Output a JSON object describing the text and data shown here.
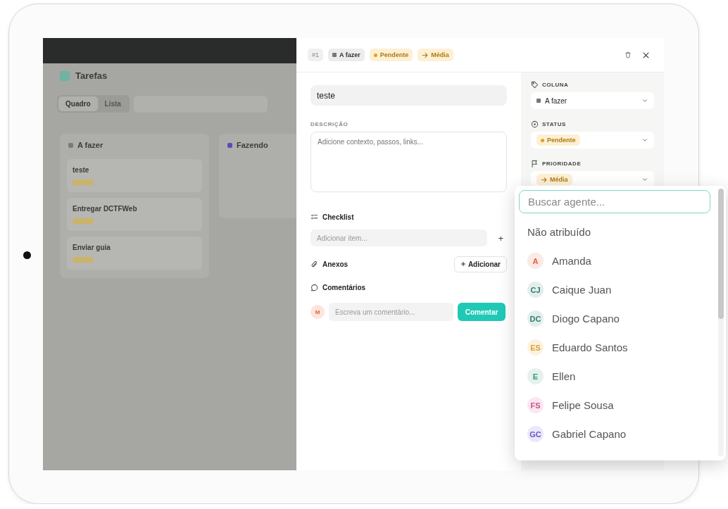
{
  "board": {
    "title": "Tarefas",
    "view_tabs": [
      {
        "label": "Quadro",
        "selected": true
      },
      {
        "label": "Lista",
        "selected": false
      }
    ],
    "columns": [
      {
        "name": "A fazer",
        "color": "#7a7a78",
        "cards": [
          {
            "title": "teste"
          },
          {
            "title": "Entregar DCTFWeb"
          },
          {
            "title": "Enviar guia"
          }
        ]
      },
      {
        "name": "Fazendo",
        "color": "#5a4bb8"
      }
    ]
  },
  "task": {
    "number": "#1",
    "badges": [
      {
        "kind": "column",
        "label": "A fazer"
      },
      {
        "kind": "status",
        "label": "Pendente"
      },
      {
        "kind": "priority",
        "label": "Média"
      }
    ],
    "title_value": "teste",
    "description": {
      "label": "DESCRIÇÃO",
      "placeholder": "Adicione contexto, passos, links..."
    },
    "checklist": {
      "label": "Checklist",
      "placeholder": "Adicionar item...",
      "add": "+"
    },
    "attachments": {
      "label": "Anexos",
      "button": "Adicionar"
    },
    "comments": {
      "label": "Comentários",
      "avatar": "M",
      "placeholder": "Escreva um comentário...",
      "button": "Comentar"
    }
  },
  "properties": [
    {
      "kind": "column",
      "label": "COLUNA",
      "value": "A fazer"
    },
    {
      "kind": "status",
      "label": "STATUS",
      "value": "Pendente"
    },
    {
      "kind": "priority",
      "label": "PRIORIDADE",
      "value": "Média"
    }
  ],
  "agent_dropdown": {
    "placeholder": "Buscar agente...",
    "unassigned": "Não atribuído",
    "agents": [
      {
        "initials": "A",
        "name": "Amanda",
        "color": "#e2623f"
      },
      {
        "initials": "CJ",
        "name": "Caique Juan",
        "color": "#2f7d6d"
      },
      {
        "initials": "DC",
        "name": "Diogo Capano",
        "color": "#2f7d6d"
      },
      {
        "initials": "ES",
        "name": "Eduardo Santos",
        "color": "#e0a12e"
      },
      {
        "initials": "E",
        "name": "Ellen",
        "color": "#3a9478"
      },
      {
        "initials": "FS",
        "name": "Felipe Sousa",
        "color": "#cf4f8c"
      },
      {
        "initials": "GC",
        "name": "Gabriel Capano",
        "color": "#6656cf"
      }
    ]
  }
}
